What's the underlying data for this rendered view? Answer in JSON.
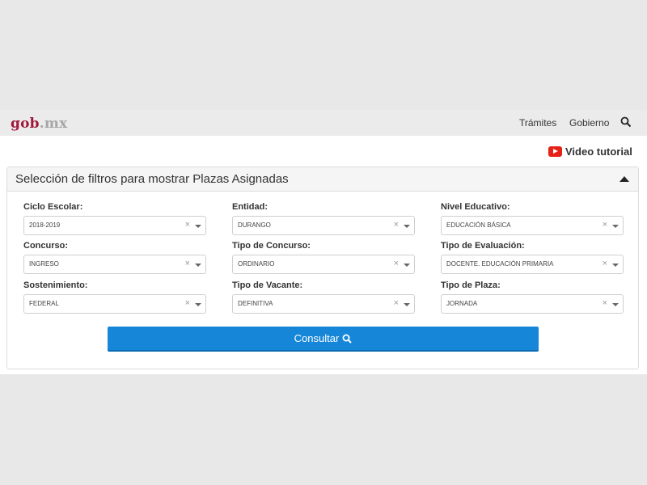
{
  "header": {
    "logo_main": "gob",
    "logo_suffix": ".mx",
    "nav": [
      "Trámites",
      "Gobierno"
    ]
  },
  "video": {
    "label": "Video tutorial"
  },
  "panel": {
    "title": "Selección de filtros para mostrar Plazas Asignadas"
  },
  "filters": [
    {
      "label": "Ciclo Escolar:",
      "value": "2018-2019"
    },
    {
      "label": "Entidad:",
      "value": "DURANGO"
    },
    {
      "label": "Nivel Educativo:",
      "value": "EDUCACIÓN BÁSICA"
    },
    {
      "label": "Concurso:",
      "value": "INGRESO"
    },
    {
      "label": "Tipo de Concurso:",
      "value": "ORDINARIO"
    },
    {
      "label": "Tipo de Evaluación:",
      "value": "DOCENTE. EDUCACIÓN PRIMARIA"
    },
    {
      "label": "Sostenimiento:",
      "value": "FEDERAL"
    },
    {
      "label": "Tipo de Vacante:",
      "value": "DEFINITIVA"
    },
    {
      "label": "Tipo de Plaza:",
      "value": "JORNADA"
    }
  ],
  "clear_glyph": "×",
  "submit": {
    "label": "Consultar"
  },
  "colors": {
    "brand": "#a1183a",
    "primary_button": "#1586d8",
    "youtube": "#e62117"
  }
}
